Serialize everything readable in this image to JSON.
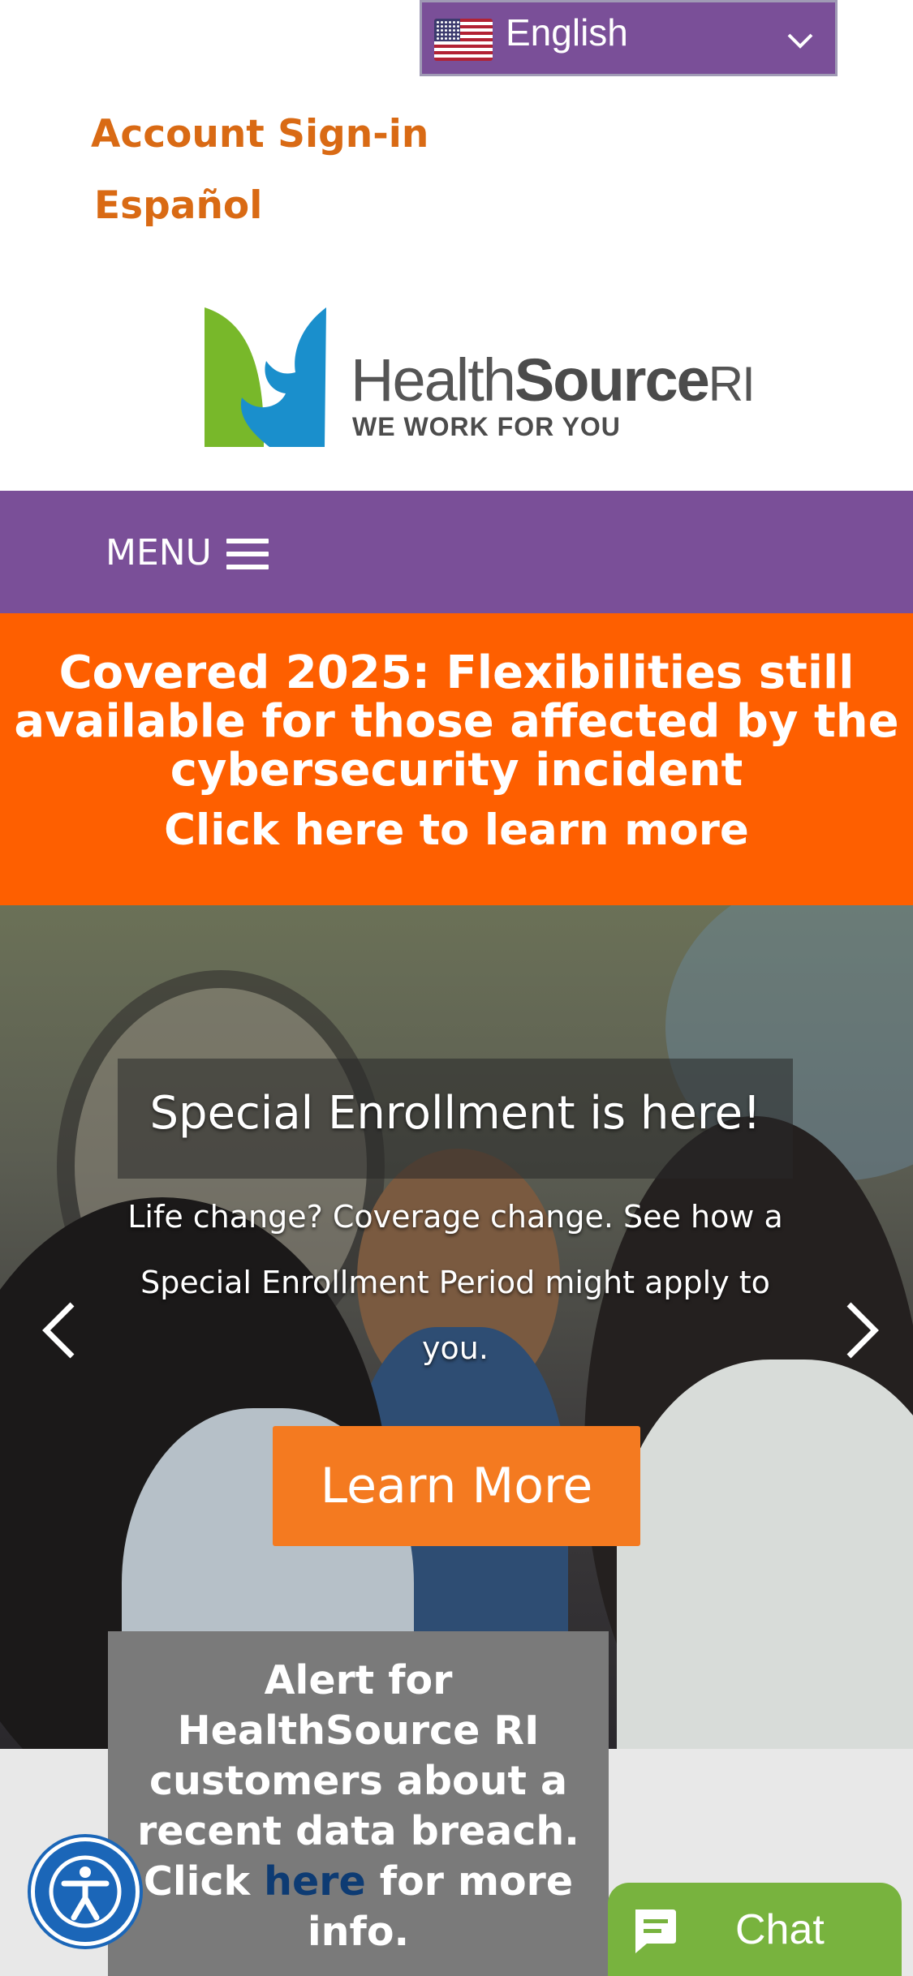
{
  "language_selector": {
    "label": "English",
    "flag_icon": "us-flag-icon",
    "chevron_icon": "chevron-down-icon"
  },
  "top_links": {
    "account_signin": "Account Sign-in",
    "espanol": "Español"
  },
  "logo": {
    "brand_regular": "Health",
    "brand_bold": "Source",
    "brand_suffix": "RI",
    "tagline": "WE WORK FOR YOU"
  },
  "menu": {
    "label": "MENU",
    "icon": "hamburger-icon"
  },
  "banner": {
    "title": "Covered 2025: Flexibilities still available for those affected by the cybersecurity incident",
    "link": "Click here to learn more"
  },
  "hero": {
    "title": "Special Enrollment is here!",
    "subtitle": "Life change? Coverage change. See how a Special Enrollment Period might apply to you.",
    "button": "Learn More",
    "prev_icon": "chevron-left-icon",
    "next_icon": "chevron-right-icon"
  },
  "alert": {
    "text_before": "Alert for HealthSource RI customers about a recent data breach. Click ",
    "link": "here",
    "text_after": " for more info."
  },
  "accessibility": {
    "icon": "accessibility-icon"
  },
  "chat": {
    "label": "Chat",
    "icon": "chat-bubble-icon"
  },
  "colors": {
    "purple": "#7a4f98",
    "orange_banner": "#fe5f00",
    "orange_button": "#f47a20",
    "orange_link": "#d96a14",
    "chat_green": "#78b33e",
    "access_blue": "#1b66b8"
  }
}
